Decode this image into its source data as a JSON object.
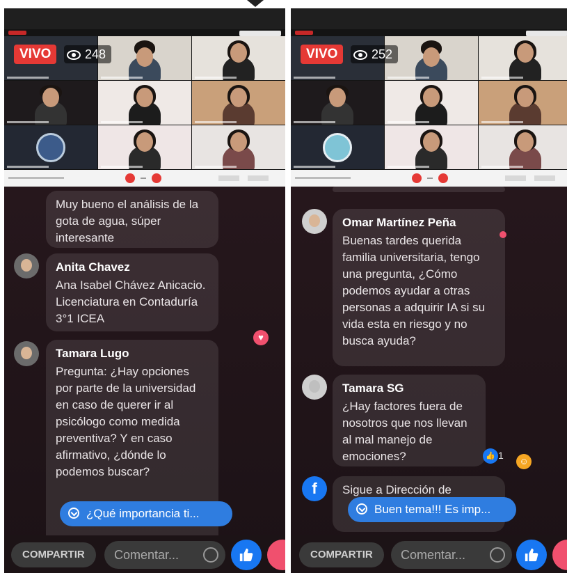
{
  "left": {
    "live_label": "VIVO",
    "viewers": "248",
    "comments": [
      {
        "author": "",
        "text": "Muy bueno el análisis de la gota de agua, súper interesante"
      },
      {
        "author": "Anita Chavez",
        "text": "Ana Isabel Chávez Anicacio. Licenciatura en Contaduría 3°1 ICEA"
      },
      {
        "author": "Tamara Lugo",
        "text": "Pregunta: ¿Hay opciones por parte de la universidad en caso de querer ir al psicólogo como medida preventiva? Y en caso afirmativo, ¿dónde lo podemos buscar?"
      }
    ],
    "pinned": "¿Qué importancia ti...",
    "footer": {
      "share": "COMPARTIR",
      "comment_placeholder": "Comentar..."
    }
  },
  "right": {
    "live_label": "VIVO",
    "viewers": "252",
    "comments": [
      {
        "author": "Omar Martínez Peña",
        "text": "Buenas tardes querida familia universitaria, tengo una pregunta, ¿Cómo podemos ayudar a otras personas a adquirir IA si su vida esta en riesgo y no busca ayuda?"
      },
      {
        "author": "Tamara SG",
        "text": "¿Hay factores fuera de nosotros que nos llevan al mal manejo de emociones?",
        "reaction_count": "1"
      },
      {
        "author": "",
        "text": "Sigue a Dirección de"
      }
    ],
    "pinned": "Buen tema!!! Es imp...",
    "footer": {
      "share": "COMPARTIR",
      "comment_placeholder": "Comentar..."
    }
  },
  "icons": [
    "eye-icon",
    "heart-icon",
    "like-icon",
    "smile-icon",
    "chevron-down-icon",
    "facebook-icon"
  ]
}
